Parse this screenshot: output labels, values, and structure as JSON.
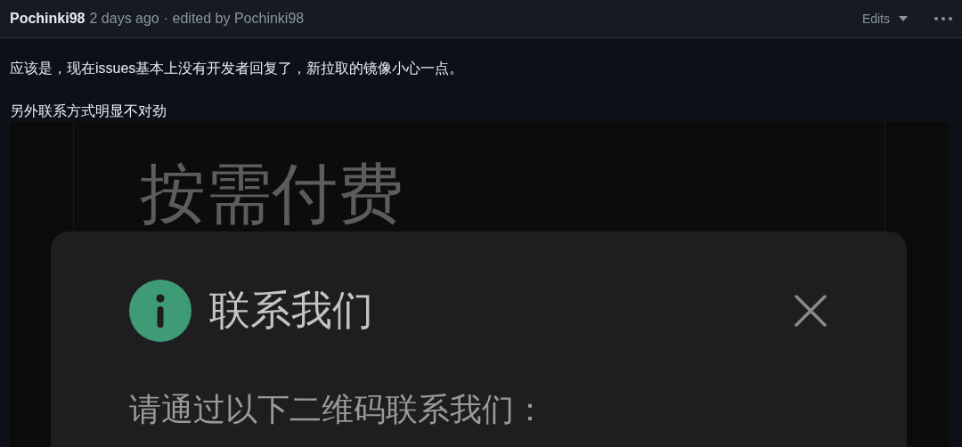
{
  "comment": {
    "author": "Pochinki98",
    "timestamp": "2 days ago",
    "edited_note": "· edited by Pochinki98",
    "edits_button": "Edits"
  },
  "paragraphs": [
    "应该是，现在issues基本上没有开发者回复了，新拉取的镜像小心一点。",
    "另外联系方式明显不对劲"
  ],
  "attachment": {
    "page_title": "按需付费",
    "dialog": {
      "title": "联系我们",
      "message": "请通过以下二维码联系我们："
    }
  }
}
